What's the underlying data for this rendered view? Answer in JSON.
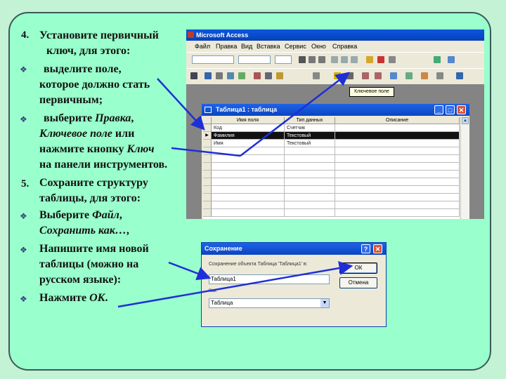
{
  "slide": {
    "step4_num": "4.",
    "step4_line1": "Установите первичный",
    "step4_line2": "ключ, для этого:",
    "b1_line1": "выделите поле,",
    "b1_line2": "которое должно стать",
    "b1_line3": "первичным;",
    "b2_pre": "выберите ",
    "b2_em1": "Правка",
    "b2_comma": ",",
    "b2_em2": "Ключевое поле",
    "b2_mid": " или",
    "b2_line3_pre": "нажмите кнопку ",
    "b2_em3": "Ключ",
    "b2_line4": "на панели инструментов.",
    "step5_num": "5.",
    "step5_line1": "Сохраните структуру",
    "step5_line2": "таблицы, для этого:",
    "b3_pre": "Выберите ",
    "b3_em1": "Файл",
    "b3_comma": ",",
    "b3_em2": "Сохранить как…",
    "b3_end": ",",
    "b4_line1": "Напишите  имя новой",
    "b4_line2": "таблицы (можно на",
    "b4_line3": "русском языке):",
    "b5_pre": "Нажмите ",
    "b5_em": "ОК",
    "b5_end": ".",
    "bullet_glyph": "❖"
  },
  "access": {
    "title": "Microsoft Access",
    "menu": [
      "Файл",
      "Правка",
      "Вид",
      "Вставка",
      "Сервис",
      "Окно",
      "Справка"
    ],
    "tooltip": "Ключевое поле"
  },
  "table_window": {
    "title": "Таблица1 : таблица",
    "col_headers": [
      "Имя поля",
      "Тип данных",
      "Описание"
    ],
    "rows": [
      {
        "field": "Код",
        "type": "Счетчик"
      },
      {
        "field": "Фамилия",
        "type": "Текстовый"
      },
      {
        "field": "Имя",
        "type": "Текстовый"
      }
    ]
  },
  "save_dialog": {
    "title": "Сохранение",
    "help_glyph": "?",
    "close_glyph": "✕",
    "label_save_as": "Сохранение объекта Таблица 'Таблица1' в:",
    "name_value": "Таблица1",
    "label_as": "Как",
    "type_value": "Таблица",
    "ok_label": "ОК",
    "cancel_label": "Отмена"
  },
  "colors": {
    "arrow": "#1f2fd6",
    "background": "#99ffcc",
    "bullet": "#3b3f86"
  }
}
